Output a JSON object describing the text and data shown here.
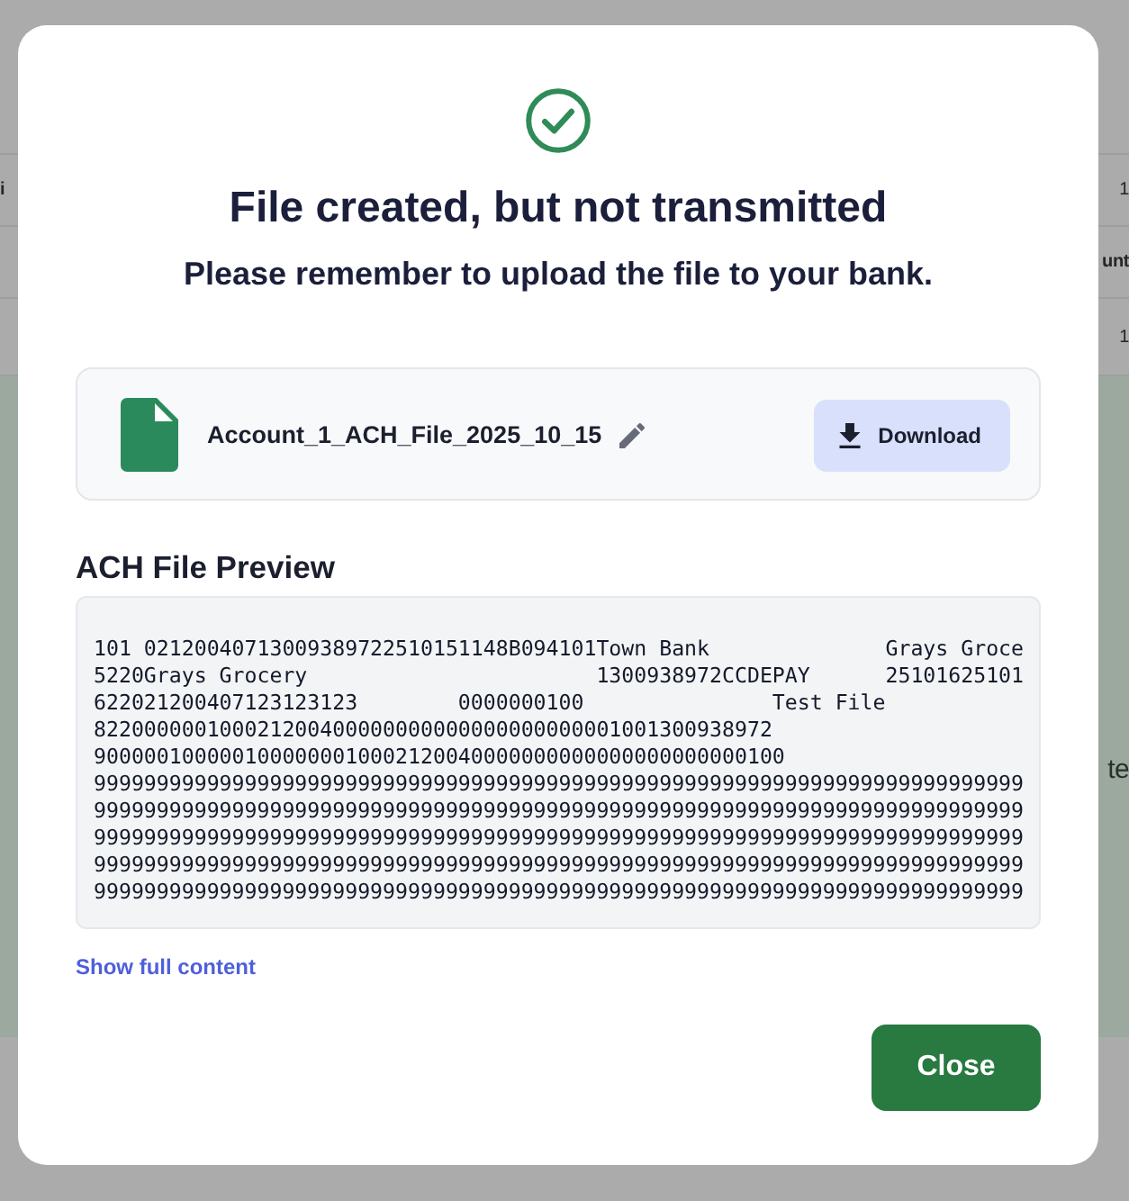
{
  "background": {
    "table_rows": [
      {
        "left": {
          "text": "i",
          "kind": "heading"
        },
        "right": {
          "text": "1",
          "kind": "value"
        }
      },
      {
        "right": {
          "text": "unt",
          "kind": "heading"
        }
      },
      {
        "right": {
          "text": "1",
          "kind": "value"
        }
      }
    ],
    "panel": {
      "text": "te"
    }
  },
  "dialog": {
    "title": "File created, but not transmitted",
    "subtitle": "Please remember to upload the file to your bank.",
    "file": {
      "name": "Account_1_ACH_File_2025_10_15",
      "download_button": "Download"
    },
    "preview": {
      "heading": "ACH File Preview",
      "lines": [
        "101 02120040713009389722510151148B094101Town Bank              Grays Groce",
        "5220Grays Grocery                       1300938972CCDEPAY      25101625101",
        "622021200407123123123        0000000100               Test File",
        "822000000100021200400000000000000000000001001300938972",
        "9000001000001000000010002120040000000000000000000000100",
        "99999999999999999999999999999999999999999999999999999999999999999999999999",
        "99999999999999999999999999999999999999999999999999999999999999999999999999",
        "99999999999999999999999999999999999999999999999999999999999999999999999999",
        "99999999999999999999999999999999999999999999999999999999999999999999999999",
        "99999999999999999999999999999999999999999999999999999999999999999999999999"
      ]
    },
    "show_full_link": "Show full content",
    "close_button": "Close"
  }
}
